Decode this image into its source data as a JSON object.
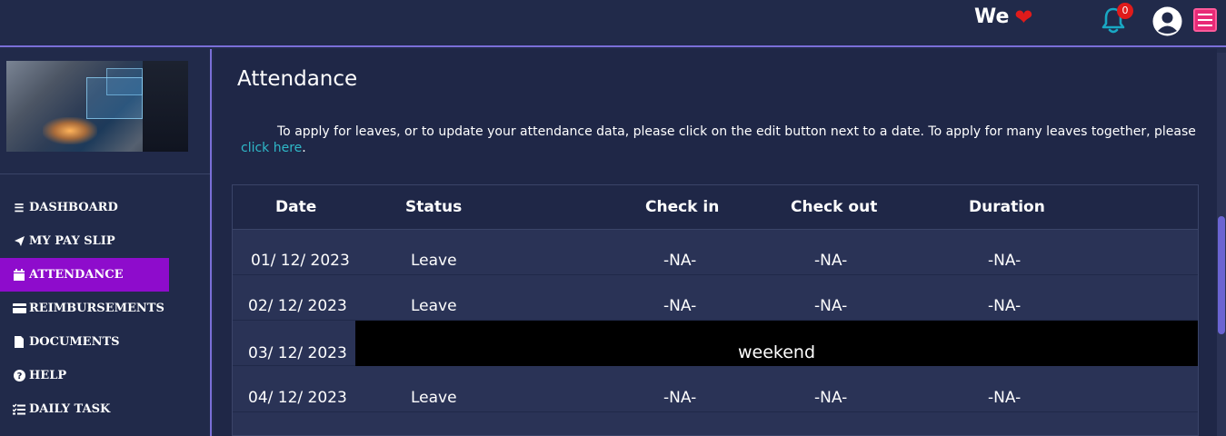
{
  "header": {
    "brand": "We",
    "notification_count": "0"
  },
  "sidebar": {
    "items": [
      {
        "icon": "bars-icon",
        "label": "DASHBOARD"
      },
      {
        "icon": "paper-plane-icon",
        "label": "MY PAY SLIP"
      },
      {
        "icon": "calendar-icon",
        "label": "ATTENDANCE",
        "active": true
      },
      {
        "icon": "credit-card-icon",
        "label": "REIMBURSEMENTS"
      },
      {
        "icon": "file-icon",
        "label": "DOCUMENTS"
      },
      {
        "icon": "question-circle-icon",
        "label": "HELP"
      },
      {
        "icon": "task-list-icon",
        "label": "DAILY TASK"
      }
    ]
  },
  "main": {
    "title": "Attendance",
    "info_text": "To apply for leaves, or to update your attendance data, please click on the edit button next to a date. To apply for many leaves together, please",
    "info_link": "click here",
    "info_end": "."
  },
  "table": {
    "headers": [
      "Date",
      "Status",
      "Check in",
      "Check out",
      "Duration"
    ],
    "rows": [
      {
        "date": "01/ 12/ 2023",
        "status": "Leave",
        "check_in": "-NA-",
        "check_out": "-NA-",
        "duration": "-NA-"
      },
      {
        "date": "02/ 12/ 2023",
        "status": "Leave",
        "check_in": "-NA-",
        "check_out": "-NA-",
        "duration": "-NA-"
      },
      {
        "date": "03/ 12/ 2023",
        "weekend": "weekend"
      },
      {
        "date": "04/ 12/ 2023",
        "status": "Leave",
        "check_in": "-NA-",
        "check_out": "-NA-",
        "duration": "-NA-"
      }
    ]
  },
  "colors": {
    "accent": "#7a6fd8",
    "active_nav": "#8e0ccc",
    "link": "#2fb8c8",
    "badge": "#e01b1b",
    "menu_button": "#e82a77"
  }
}
